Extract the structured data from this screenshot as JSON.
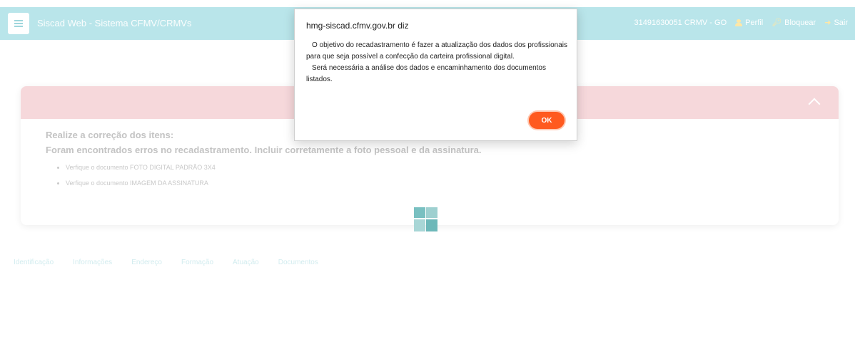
{
  "navbar": {
    "title": "Siscad Web - Sistema CFMV/CRMVs",
    "user": "31491630051 CRMV - GO",
    "profile": "Perfil",
    "lock": "Bloquear",
    "logout": "Sair"
  },
  "card": {
    "fix_title": "Realize a correção dos itens:",
    "error_message": "Foram encontrados erros no recadastramento. Incluir corretamente a foto pessoal e da assinatura.",
    "items": [
      "Verfique o documento FOTO DIGITAL PADRÃO 3X4",
      "Verfique o documento IMAGEM DA ASSINATURA"
    ]
  },
  "tabs": [
    "Identificação",
    "Informações",
    "Endereço",
    "Formação",
    "Atuação",
    "Documentos"
  ],
  "dialog": {
    "origin": "hmg-siscad.cfmv.gov.br diz",
    "line1": "O objetivo do recadastramento é fazer a atualização dos dados dos profissionais para que seja possível a confecção da carteira profissional digital.",
    "line2": "Será necessária a análise dos dados e encaminhamento dos documentos listados.",
    "ok": "OK"
  },
  "colors": {
    "navbar": "#b9e5ea",
    "card_header": "#f6d8db",
    "ok_button": "#ff5a1f"
  }
}
